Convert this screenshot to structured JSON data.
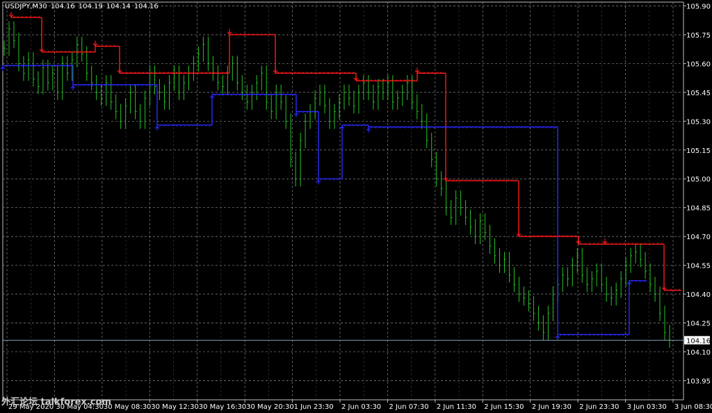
{
  "header": {
    "symbol": "USDJPY,M30",
    "open": "104.16",
    "high": "104.19",
    "low": "104.14",
    "close": "104.16"
  },
  "watermark": "外汇论坛 talkforex.com",
  "colors": {
    "background": "#000000",
    "grid": "#8a8a8a",
    "axis": "#c0c0c0",
    "candles": "#27c427",
    "resistance": "#ff1a1a",
    "support": "#2a2aff",
    "bid_line": "#7fa0b0",
    "label_text": "#ffffff",
    "price_tag_bg": "#ffffff",
    "price_tag_text": "#000000"
  },
  "chart_data": {
    "type": "line",
    "ylim": [
      103.85,
      105.92
    ],
    "grid": true,
    "y_ticks": [
      "105.90",
      "105.75",
      "105.60",
      "105.45",
      "105.30",
      "105.15",
      "105.00",
      "104.85",
      "104.70",
      "104.55",
      "104.40",
      "104.25",
      "104.10",
      "103.95"
    ],
    "x_ticks": [
      "29 May 2020",
      "30 May 04:30",
      "30 May 08:30",
      "30 May 12:30",
      "30 May 16:30",
      "30 May 20:30",
      "1 Jun 23:30",
      "2 Jun 03:30",
      "2 Jun 07:30",
      "2 Jun 11:30",
      "2 Jun 15:30",
      "2 Jun 19:30",
      "2 Jun 23:30",
      "3 Jun 03:30",
      "3 Jun 08:30"
    ],
    "last_price": "104.16",
    "close_series": [
      105.68,
      105.78,
      105.72,
      105.6,
      105.55,
      105.62,
      105.52,
      105.48,
      105.58,
      105.5,
      105.55,
      105.45,
      105.6,
      105.55,
      105.62,
      105.7,
      105.65,
      105.55,
      105.5,
      105.45,
      105.42,
      105.5,
      105.4,
      105.35,
      105.3,
      105.38,
      105.45,
      105.35,
      105.3,
      105.42,
      105.55,
      105.48,
      105.45,
      105.4,
      105.5,
      105.55,
      105.45,
      105.5,
      105.55,
      105.6,
      105.65,
      105.7,
      105.6,
      105.55,
      105.5,
      105.48,
      105.55,
      105.6,
      105.5,
      105.45,
      105.4,
      105.45,
      105.5,
      105.55,
      105.4,
      105.35,
      105.45,
      105.4,
      105.3,
      105.1,
      105.0,
      105.2,
      105.3,
      105.35,
      105.42,
      105.45,
      105.38,
      105.3,
      105.35,
      105.4,
      105.45,
      105.42,
      105.38,
      105.45,
      105.5,
      105.45,
      105.4,
      105.48,
      105.45,
      105.5,
      105.4,
      105.42,
      105.45,
      105.5,
      105.4,
      105.35,
      105.3,
      105.2,
      105.1,
      105.0,
      104.95,
      104.85,
      104.8,
      104.9,
      104.85,
      104.8,
      104.75,
      104.7,
      104.78,
      104.72,
      104.65,
      104.6,
      104.55,
      104.58,
      104.5,
      104.45,
      104.4,
      104.38,
      104.35,
      104.3,
      104.25,
      104.2,
      104.3,
      104.4,
      104.45,
      104.5,
      104.48,
      104.55,
      104.6,
      104.5,
      104.45,
      104.48,
      104.52,
      104.45,
      104.4,
      104.38,
      104.42,
      104.48,
      104.55,
      104.6,
      104.62,
      104.58,
      104.52,
      104.45,
      104.4,
      104.3,
      104.2,
      104.16
    ],
    "series": [
      {
        "name": "",
        "style": "step",
        "role": "resistance",
        "x": [
          "29 May 2020",
          "30 May 04:30",
          "30 May 08:30",
          "30 May 12:30",
          "30 May 16:30",
          "30 May 20:30",
          "2 Jun 03:30",
          "2 Jun 07:30",
          "2 Jun 11:30",
          "2 Jun 15:30",
          "2 Jun 19:30",
          "2 Jun 23:30",
          "3 Jun 03:30"
        ],
        "values": [
          105.84,
          105.66,
          105.69,
          105.55,
          105.75,
          105.55,
          105.51,
          105.55,
          104.99,
          104.7,
          104.66,
          104.66,
          104.42
        ]
      },
      {
        "name": "",
        "style": "step",
        "role": "support",
        "values": [
          105.59,
          105.49,
          105.28,
          105.44,
          105.35,
          105.0,
          105.28,
          105.27,
          104.19,
          104.47
        ]
      }
    ]
  }
}
